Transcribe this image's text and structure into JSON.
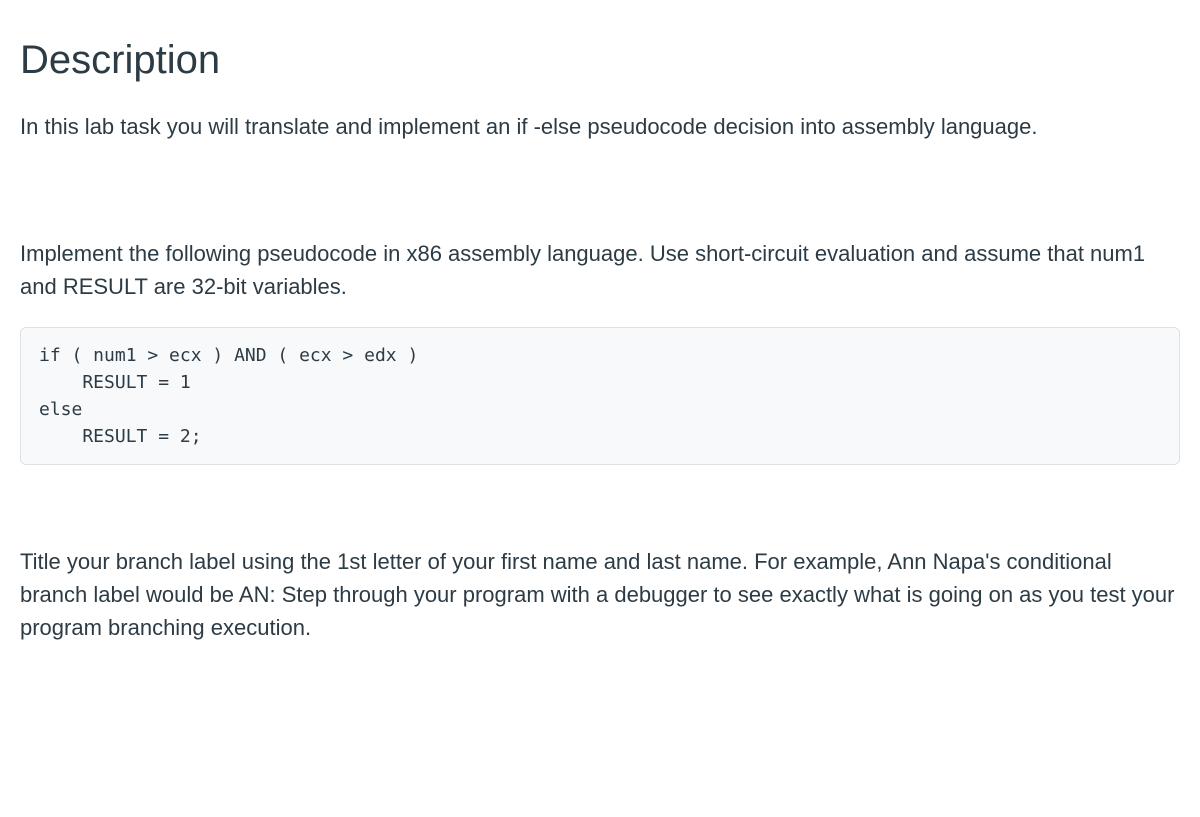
{
  "heading": "Description",
  "para1": "In this lab task you will translate and implement an if -else pseudocode decision into assembly language.",
  "para2": "Implement the following pseudocode in x86 assembly language.  Use short-circuit evaluation and assume that num1 and RESULT are 32-bit variables.",
  "code": "if ( num1 > ecx ) AND ( ecx > edx )\n    RESULT = 1\nelse\n    RESULT = 2;",
  "para3": "Title your branch label using the 1st letter of your first name and last name.  For example, Ann Napa's conditional branch label would be AN:  Step through your program with a debugger to see exactly what is going on as you test your program branching execution."
}
